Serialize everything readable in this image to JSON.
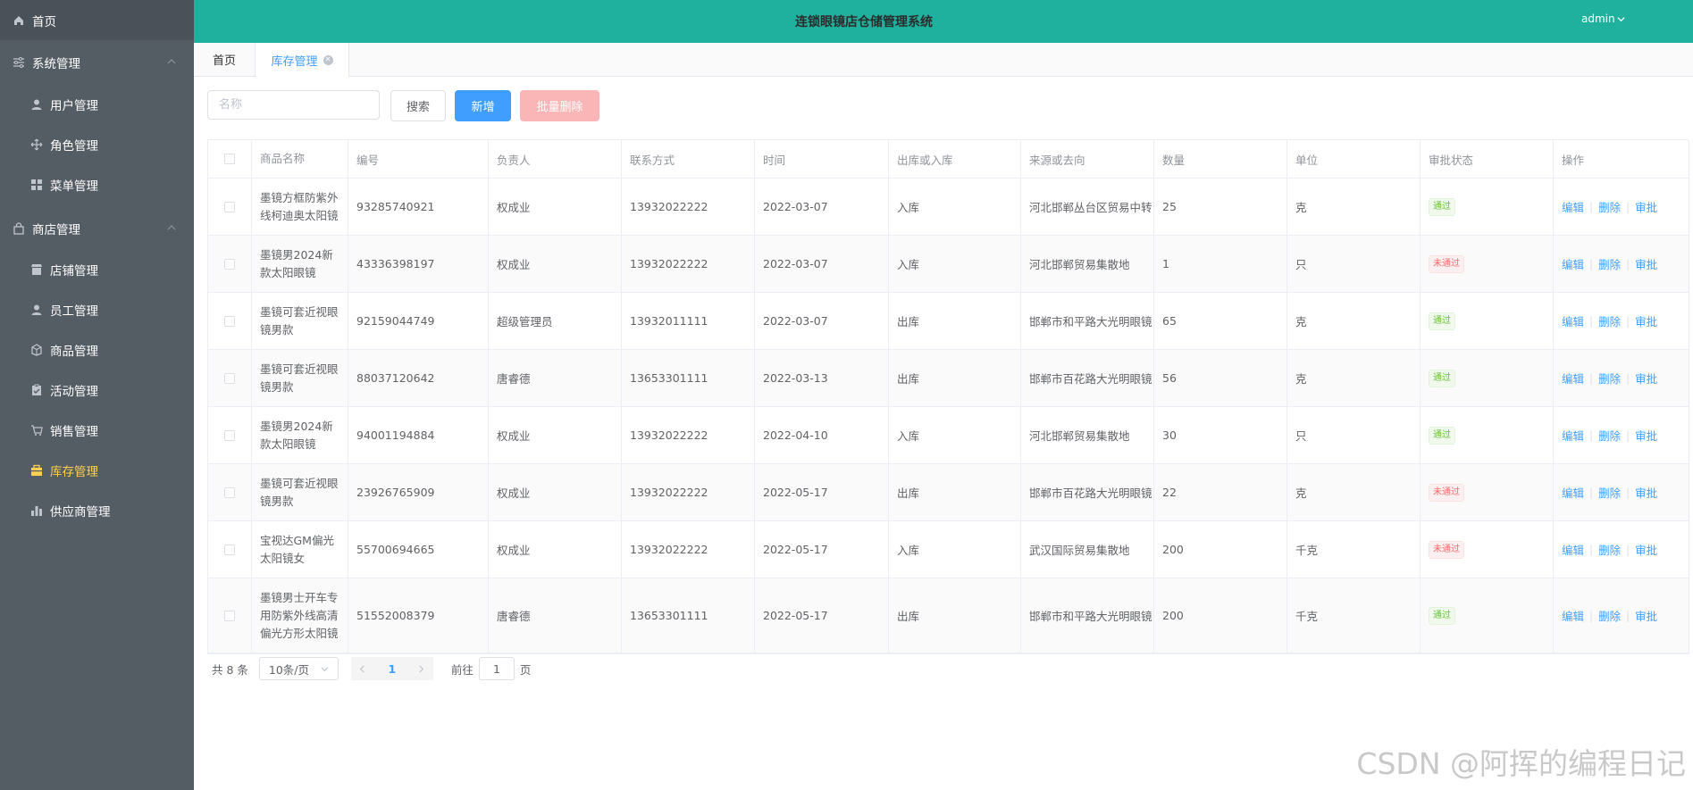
{
  "sidebar": {
    "items": [
      {
        "label": "首页",
        "icon": "home-icon"
      },
      {
        "label": "系统管理",
        "icon": "sliders-icon"
      },
      {
        "label": "用户管理",
        "icon": "user-icon"
      },
      {
        "label": "角色管理",
        "icon": "move-icon"
      },
      {
        "label": "菜单管理",
        "icon": "grid-icon"
      },
      {
        "label": "商店管理",
        "icon": "bag-icon"
      },
      {
        "label": "店铺管理",
        "icon": "shop-icon"
      },
      {
        "label": "员工管理",
        "icon": "user-icon"
      },
      {
        "label": "商品管理",
        "icon": "goods-icon"
      },
      {
        "label": "活动管理",
        "icon": "clipboard-icon"
      },
      {
        "label": "销售管理",
        "icon": "cart-icon"
      },
      {
        "label": "库存管理",
        "icon": "box-icon"
      },
      {
        "label": "供应商管理",
        "icon": "bar-chart-icon"
      }
    ],
    "active_color": "#ffd04b",
    "background": "#545c64"
  },
  "header": {
    "title": "连锁眼镜店仓储管理系统",
    "user": "admin",
    "background": "#1fb19e"
  },
  "tabs": [
    {
      "label": "首页"
    },
    {
      "label": "库存管理"
    }
  ],
  "toolbar": {
    "search_placeholder": "名称",
    "search_label": "搜索",
    "add_label": "新增",
    "batch_delete_label": "批量删除"
  },
  "table": {
    "columns": [
      "商品名称",
      "编号",
      "负责人",
      "联系方式",
      "时间",
      "出库或入库",
      "来源或去向",
      "数量",
      "单位",
      "审批状态",
      "操作"
    ],
    "rows": [
      {
        "name": "墨镜方框防紫外线柯迪奥太阳镜",
        "code": "93285740921",
        "owner": "权成业",
        "phone": "13932022222",
        "time": "2022-03-07",
        "direction": "入库",
        "source": "河北邯郸丛台区贸易中转",
        "qty": "25",
        "unit": "克",
        "status": "通过",
        "status_type": "pass"
      },
      {
        "name": "墨镜男2024新款太阳眼镜",
        "code": "43336398197",
        "owner": "权成业",
        "phone": "13932022222",
        "time": "2022-03-07",
        "direction": "入库",
        "source": "河北邯郸贸易集散地",
        "qty": "1",
        "unit": "只",
        "status": "未通过",
        "status_type": "fail"
      },
      {
        "name": "墨镜可套近视眼镜男款",
        "code": "92159044749",
        "owner": "超级管理员",
        "phone": "13932011111",
        "time": "2022-03-07",
        "direction": "出库",
        "source": "邯郸市和平路大光明眼镜",
        "qty": "65",
        "unit": "克",
        "status": "通过",
        "status_type": "pass"
      },
      {
        "name": "墨镜可套近视眼镜男款",
        "code": "88037120642",
        "owner": "唐睿德",
        "phone": "13653301111",
        "time": "2022-03-13",
        "direction": "出库",
        "source": "邯郸市百花路大光明眼镜",
        "qty": "56",
        "unit": "克",
        "status": "通过",
        "status_type": "pass"
      },
      {
        "name": "墨镜男2024新款太阳眼镜",
        "code": "94001194884",
        "owner": "权成业",
        "phone": "13932022222",
        "time": "2022-04-10",
        "direction": "入库",
        "source": "河北邯郸贸易集散地",
        "qty": "30",
        "unit": "只",
        "status": "通过",
        "status_type": "pass"
      },
      {
        "name": "墨镜可套近视眼镜男款",
        "code": "23926765909",
        "owner": "权成业",
        "phone": "13932022222",
        "time": "2022-05-17",
        "direction": "出库",
        "source": "邯郸市百花路大光明眼镜",
        "qty": "22",
        "unit": "克",
        "status": "未通过",
        "status_type": "fail"
      },
      {
        "name": "宝视达GM偏光太阳镜女",
        "code": "55700694665",
        "owner": "权成业",
        "phone": "13932022222",
        "time": "2022-05-17",
        "direction": "入库",
        "source": "武汉国际贸易集散地",
        "qty": "200",
        "unit": "千克",
        "status": "未通过",
        "status_type": "fail"
      },
      {
        "name": "墨镜男士开车专用防紫外线高清偏光方形太阳镜",
        "code": "51552008379",
        "owner": "唐睿德",
        "phone": "13653301111",
        "time": "2022-05-17",
        "direction": "出库",
        "source": "邯郸市和平路大光明眼镜",
        "qty": "200",
        "unit": "千克",
        "status": "通过",
        "status_type": "pass"
      }
    ],
    "actions": {
      "edit": "编辑",
      "delete": "删除",
      "approve": "审批"
    }
  },
  "pagination": {
    "total_text": "共 8 条",
    "page_size": "10条/页",
    "current_page": "1",
    "goto_prefix": "前往",
    "goto_value": "1",
    "goto_suffix": "页"
  },
  "watermark": "CSDN @阿挥的编程日记"
}
